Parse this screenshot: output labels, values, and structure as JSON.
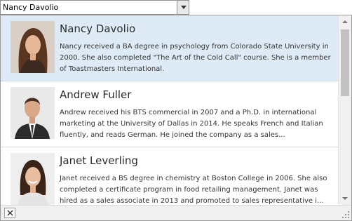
{
  "combo": {
    "value": "Nancy Davolio",
    "dropdown_icon": "chevron-down-icon"
  },
  "employees": [
    {
      "name": "Nancy Davolio",
      "notes": "Nancy received a BA degree in psychology from Colorado State University in\n2000. She also completed \"The Art of the Cold Call\" course. She is a member\nof Toastmasters International.",
      "selected": true
    },
    {
      "name": "Andrew Fuller",
      "notes": "Andrew received his BTS commercial in 2007 and a Ph.D. in international\nmarketing at the University of Dallas in 2014. He speaks French and Italian\nfluently, and reads German. He joined the company as a sales...",
      "selected": false
    },
    {
      "name": "Janet Leverling",
      "notes": "Janet received a BS degree in chemistry at Boston College in 2006. She also\ncompleted a certificate program in food retailing management. Janet was\nhired as a sales associate in 2013 and promoted to sales representative i...",
      "selected": false
    }
  ],
  "footer": {
    "close_icon": "close-icon",
    "grip_icon": "resize-grip-icon"
  },
  "colors": {
    "selected_row": "#deebf7",
    "scroll_thumb": "#c2c2c2"
  }
}
